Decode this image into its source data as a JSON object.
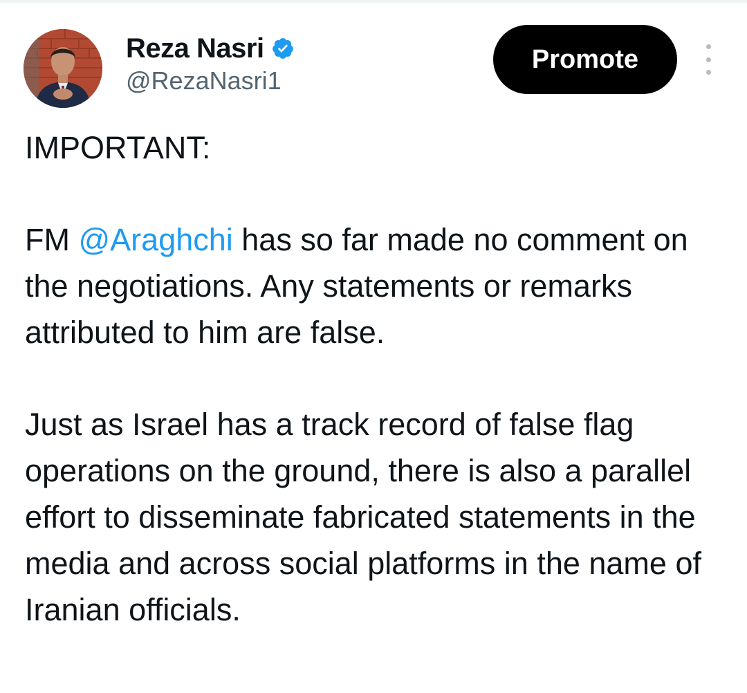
{
  "author": {
    "display_name": "Reza Nasri",
    "handle": "@RezaNasri1",
    "verified_icon": "verified-badge-icon",
    "badge_color": "#1d9bf0"
  },
  "actions": {
    "promote_label": "Promote",
    "more_icon": "vertical-ellipsis-icon"
  },
  "tweet": {
    "heading": "IMPORTANT:",
    "p1_prefix": "FM ",
    "p1_mention": "@Araghchi",
    "p1_rest": " has so far made no comment on the negotiations. Any statements or remarks attributed to him are false.",
    "p2": "Just as Israel has a track record of false flag operations on the ground, there is also a parallel effort to disseminate fabricated statements in the media and across social platforms in the name of Iranian officials."
  },
  "colors": {
    "text": "#0f1419",
    "secondary": "#536471",
    "link": "#1d9bf0",
    "button_bg": "#000000",
    "button_text": "#ffffff"
  }
}
